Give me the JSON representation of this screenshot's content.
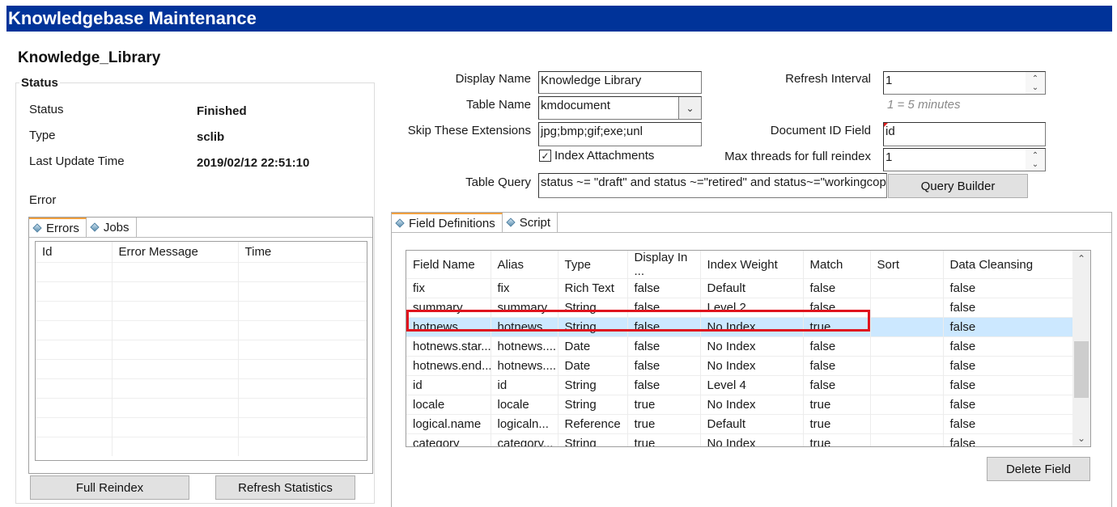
{
  "window": {
    "title": "Knowledgebase Maintenance"
  },
  "library_name": "Knowledge_Library",
  "status_group": {
    "legend": "Status",
    "rows": [
      {
        "label": "Status",
        "value": "Finished"
      },
      {
        "label": "Type",
        "value": "sclib"
      },
      {
        "label": "Last Update Time",
        "value": "2019/02/12 22:51:10"
      }
    ],
    "error_label": "Error",
    "tabs": [
      {
        "label": "Errors",
        "icon": "diamond-icon",
        "active": true
      },
      {
        "label": "Jobs",
        "icon": "diamond-icon",
        "active": false
      }
    ],
    "errors_table": {
      "columns": [
        "Id",
        "Error Message",
        "Time"
      ],
      "rows": []
    },
    "buttons": {
      "full_reindex": "Full Reindex",
      "refresh_statistics": "Refresh Statistics"
    }
  },
  "form": {
    "display_name": {
      "label": "Display Name",
      "value": "Knowledge Library"
    },
    "table_name": {
      "label": "Table Name",
      "value": "kmdocument"
    },
    "skip_extensions": {
      "label": "Skip These Extensions",
      "value": "jpg;bmp;gif;exe;unl"
    },
    "index_attachments": {
      "label": "Index Attachments",
      "checked": true
    },
    "table_query": {
      "label": "Table Query",
      "value": "status ~= \"draft\"  and status ~=\"retired\" and status~=\"workingcopy\""
    },
    "query_builder_button": "Query Builder",
    "refresh_interval": {
      "label": "Refresh Interval",
      "value": "1",
      "hint": "1 = 5 minutes"
    },
    "document_id_field": {
      "label": "Document ID Field",
      "value": "id"
    },
    "max_threads": {
      "label": "Max threads for full reindex",
      "value": "1"
    }
  },
  "field_panel": {
    "tabs": [
      {
        "label": "Field Definitions",
        "icon": "diamond-icon",
        "active": true
      },
      {
        "label": "Script",
        "icon": "diamond-icon",
        "active": false
      }
    ],
    "columns": [
      "Field Name",
      "Alias",
      "Type",
      "Display In ...",
      "Index Weight",
      "Match",
      "Sort",
      "Data Cleansing"
    ],
    "rows": [
      [
        "fix",
        "fix",
        "Rich Text",
        "false",
        "Default",
        "false",
        "",
        "false"
      ],
      [
        "summary",
        "summary",
        "String",
        "false",
        "Level 2",
        "false",
        "",
        "false"
      ],
      [
        "hotnews",
        "hotnews",
        "String",
        "false",
        "No Index",
        "true",
        "",
        "false"
      ],
      [
        "hotnews.star...",
        "hotnews....",
        "Date",
        "false",
        "No Index",
        "false",
        "",
        "false"
      ],
      [
        "hotnews.end...",
        "hotnews....",
        "Date",
        "false",
        "No Index",
        "false",
        "",
        "false"
      ],
      [
        "id",
        "id",
        "String",
        "false",
        "Level 4",
        "false",
        "",
        "false"
      ],
      [
        "locale",
        "locale",
        "String",
        "true",
        "No Index",
        "true",
        "",
        "false"
      ],
      [
        "logical.name",
        "logicaln...",
        "Reference",
        "true",
        "Default",
        "true",
        "",
        "false"
      ],
      [
        "category",
        "category...",
        "String",
        "true",
        "No Index",
        "true",
        "",
        "false"
      ]
    ],
    "selected_row_index": 2,
    "highlight_color": "#e0141e",
    "delete_button": "Delete Field"
  }
}
